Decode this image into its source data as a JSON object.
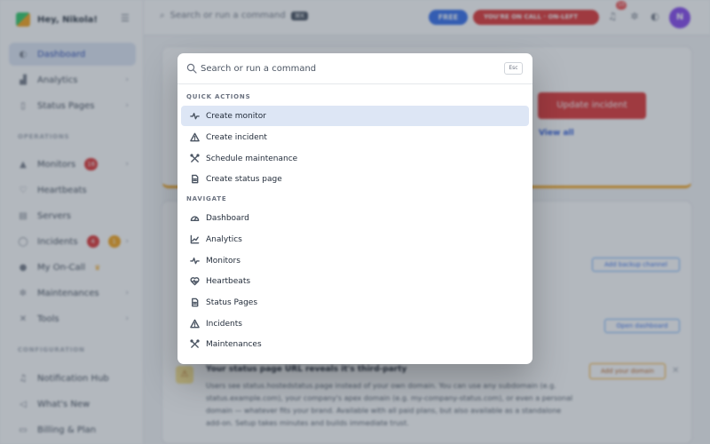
{
  "sidebar": {
    "brand": "Hey, Nikola!",
    "items": [
      {
        "label": "Dashboard"
      },
      {
        "label": "Analytics"
      },
      {
        "label": "Status Pages"
      },
      {
        "label": "Monitors",
        "badge": "16"
      },
      {
        "label": "Heartbeats"
      },
      {
        "label": "Servers"
      },
      {
        "label": "Incidents",
        "badge": "4",
        "badge2": "1"
      },
      {
        "label": "My On-Call"
      },
      {
        "label": "Maintenances"
      },
      {
        "label": "Tools"
      },
      {
        "label": "Notification Hub"
      },
      {
        "label": "What's New"
      },
      {
        "label": "Billing & Plan"
      }
    ],
    "sections": {
      "operations": "OPERATIONS",
      "configuration": "CONFIGURATION"
    }
  },
  "topbar": {
    "search_label": "Search or run a command",
    "search_kbd": "⌘K",
    "plan_badge": "FREE",
    "oncall_badge": "YOU'RE ON CALL",
    "oncall_sub": "ON-LEFT",
    "notifications_count": "10",
    "avatar_initial": "N"
  },
  "main": {
    "update_button": "Update incident",
    "view_all": "View all",
    "backup_button": "Add backup channel",
    "dashboard_button": "Open dashboard",
    "warning": {
      "title": "Your status page URL reveals it's third-party",
      "text": "Users see status.hostedstatus.page instead of your own domain. You can use any subdomain (e.g. status.example.com), your company's apex domain (e.g. my-company-status.com), or even a personal domain — whatever fits your brand. Available with all paid plans, but also available as a standalone add-on. Setup takes minutes and builds immediate trust.",
      "button": "Add your domain"
    }
  },
  "palette": {
    "placeholder": "Search or run a command",
    "esc": "Esc",
    "groups": [
      {
        "label": "QUICK ACTIONS",
        "items": [
          {
            "label": "Create monitor",
            "icon": "activity-icon",
            "selected": true
          },
          {
            "label": "Create incident",
            "icon": "warning-icon"
          },
          {
            "label": "Schedule maintenance",
            "icon": "tools-icon"
          },
          {
            "label": "Create status page",
            "icon": "document-icon"
          }
        ]
      },
      {
        "label": "NAVIGATE",
        "items": [
          {
            "label": "Dashboard",
            "icon": "gauge-icon"
          },
          {
            "label": "Analytics",
            "icon": "chart-icon"
          },
          {
            "label": "Monitors",
            "icon": "activity-icon"
          },
          {
            "label": "Heartbeats",
            "icon": "heart-pulse-icon"
          },
          {
            "label": "Status Pages",
            "icon": "document-icon"
          },
          {
            "label": "Incidents",
            "icon": "warning-icon"
          },
          {
            "label": "Maintenances",
            "icon": "tools-icon"
          }
        ]
      }
    ]
  }
}
